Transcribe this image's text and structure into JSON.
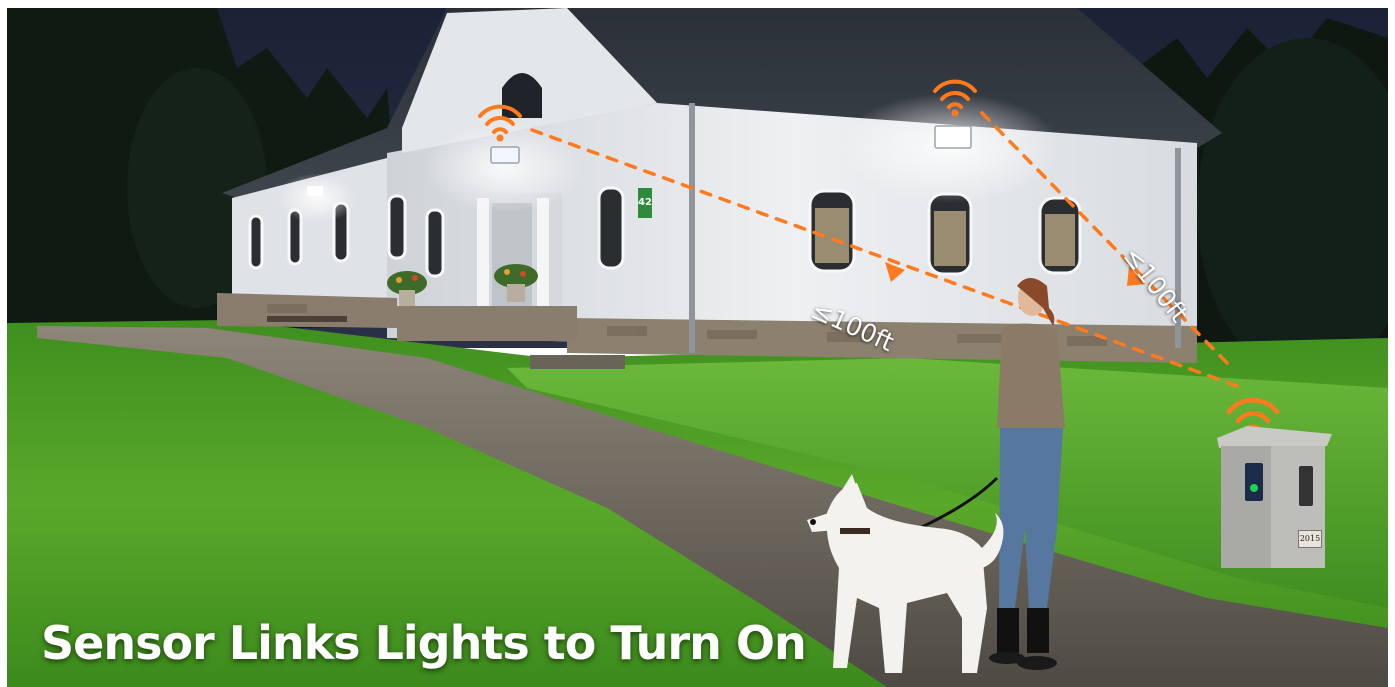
{
  "headline": "Sensor Links Lights to Turn On",
  "distance_labels": [
    "≤100ft",
    "≤100ft"
  ],
  "house_number": "42",
  "sensor_post_plate": "2015",
  "colors": {
    "signal_orange": "#ff7a1f",
    "night_sky": "#141a2b",
    "lawn_green": "#4fae2a",
    "house_wall": "#e9ecef",
    "headline_text": "#ffffff"
  },
  "icons": [
    "wifi-signal-icon",
    "flood-light-icon",
    "motion-sensor-icon"
  ]
}
